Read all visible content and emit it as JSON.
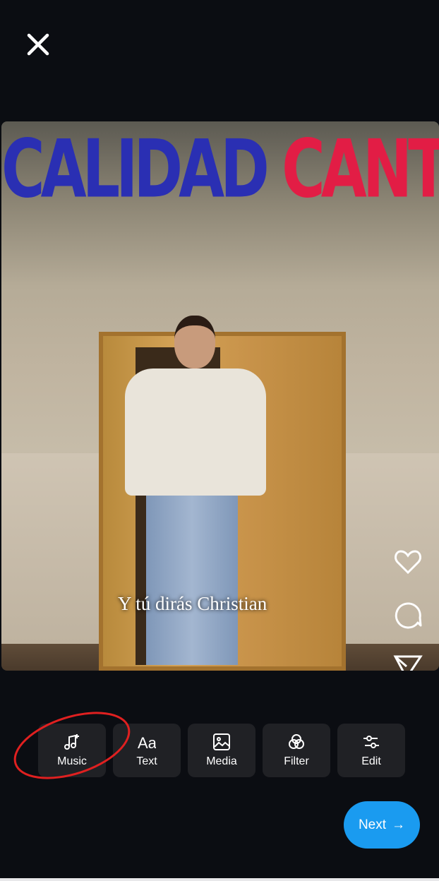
{
  "video": {
    "headline_left": "CALIDAD",
    "headline_right": "CANTIDAD",
    "caption": "Y tú dirás Christian"
  },
  "side_actions": [
    {
      "icon": "heart-icon"
    },
    {
      "icon": "comment-icon"
    },
    {
      "icon": "send-icon"
    }
  ],
  "toolbar": {
    "items": [
      {
        "label": "Music",
        "icon": "music-add-icon"
      },
      {
        "label": "Text",
        "icon": "text-icon"
      },
      {
        "label": "Media",
        "icon": "image-icon"
      },
      {
        "label": "Filter",
        "icon": "filter-icon"
      },
      {
        "label": "Edit",
        "icon": "sliders-icon"
      }
    ]
  },
  "next_label": "Next",
  "colors": {
    "accent": "#1a9bf0",
    "annotation": "#e02020",
    "headline_blue": "#2a2fb3",
    "headline_red": "#e21d45"
  }
}
